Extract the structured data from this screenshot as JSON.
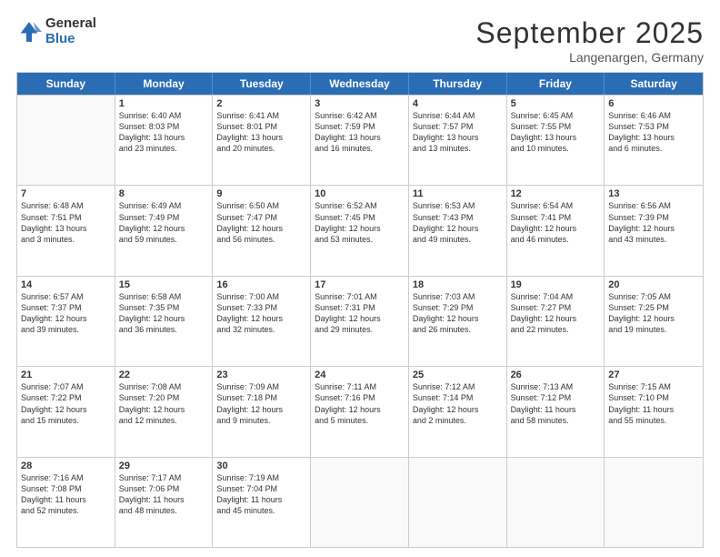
{
  "logo": {
    "general": "General",
    "blue": "Blue"
  },
  "header": {
    "month": "September 2025",
    "location": "Langenargen, Germany"
  },
  "weekdays": [
    "Sunday",
    "Monday",
    "Tuesday",
    "Wednesday",
    "Thursday",
    "Friday",
    "Saturday"
  ],
  "rows": [
    [
      {
        "day": "",
        "text": ""
      },
      {
        "day": "1",
        "text": "Sunrise: 6:40 AM\nSunset: 8:03 PM\nDaylight: 13 hours\nand 23 minutes."
      },
      {
        "day": "2",
        "text": "Sunrise: 6:41 AM\nSunset: 8:01 PM\nDaylight: 13 hours\nand 20 minutes."
      },
      {
        "day": "3",
        "text": "Sunrise: 6:42 AM\nSunset: 7:59 PM\nDaylight: 13 hours\nand 16 minutes."
      },
      {
        "day": "4",
        "text": "Sunrise: 6:44 AM\nSunset: 7:57 PM\nDaylight: 13 hours\nand 13 minutes."
      },
      {
        "day": "5",
        "text": "Sunrise: 6:45 AM\nSunset: 7:55 PM\nDaylight: 13 hours\nand 10 minutes."
      },
      {
        "day": "6",
        "text": "Sunrise: 6:46 AM\nSunset: 7:53 PM\nDaylight: 13 hours\nand 6 minutes."
      }
    ],
    [
      {
        "day": "7",
        "text": "Sunrise: 6:48 AM\nSunset: 7:51 PM\nDaylight: 13 hours\nand 3 minutes."
      },
      {
        "day": "8",
        "text": "Sunrise: 6:49 AM\nSunset: 7:49 PM\nDaylight: 12 hours\nand 59 minutes."
      },
      {
        "day": "9",
        "text": "Sunrise: 6:50 AM\nSunset: 7:47 PM\nDaylight: 12 hours\nand 56 minutes."
      },
      {
        "day": "10",
        "text": "Sunrise: 6:52 AM\nSunset: 7:45 PM\nDaylight: 12 hours\nand 53 minutes."
      },
      {
        "day": "11",
        "text": "Sunrise: 6:53 AM\nSunset: 7:43 PM\nDaylight: 12 hours\nand 49 minutes."
      },
      {
        "day": "12",
        "text": "Sunrise: 6:54 AM\nSunset: 7:41 PM\nDaylight: 12 hours\nand 46 minutes."
      },
      {
        "day": "13",
        "text": "Sunrise: 6:56 AM\nSunset: 7:39 PM\nDaylight: 12 hours\nand 43 minutes."
      }
    ],
    [
      {
        "day": "14",
        "text": "Sunrise: 6:57 AM\nSunset: 7:37 PM\nDaylight: 12 hours\nand 39 minutes."
      },
      {
        "day": "15",
        "text": "Sunrise: 6:58 AM\nSunset: 7:35 PM\nDaylight: 12 hours\nand 36 minutes."
      },
      {
        "day": "16",
        "text": "Sunrise: 7:00 AM\nSunset: 7:33 PM\nDaylight: 12 hours\nand 32 minutes."
      },
      {
        "day": "17",
        "text": "Sunrise: 7:01 AM\nSunset: 7:31 PM\nDaylight: 12 hours\nand 29 minutes."
      },
      {
        "day": "18",
        "text": "Sunrise: 7:03 AM\nSunset: 7:29 PM\nDaylight: 12 hours\nand 26 minutes."
      },
      {
        "day": "19",
        "text": "Sunrise: 7:04 AM\nSunset: 7:27 PM\nDaylight: 12 hours\nand 22 minutes."
      },
      {
        "day": "20",
        "text": "Sunrise: 7:05 AM\nSunset: 7:25 PM\nDaylight: 12 hours\nand 19 minutes."
      }
    ],
    [
      {
        "day": "21",
        "text": "Sunrise: 7:07 AM\nSunset: 7:22 PM\nDaylight: 12 hours\nand 15 minutes."
      },
      {
        "day": "22",
        "text": "Sunrise: 7:08 AM\nSunset: 7:20 PM\nDaylight: 12 hours\nand 12 minutes."
      },
      {
        "day": "23",
        "text": "Sunrise: 7:09 AM\nSunset: 7:18 PM\nDaylight: 12 hours\nand 9 minutes."
      },
      {
        "day": "24",
        "text": "Sunrise: 7:11 AM\nSunset: 7:16 PM\nDaylight: 12 hours\nand 5 minutes."
      },
      {
        "day": "25",
        "text": "Sunrise: 7:12 AM\nSunset: 7:14 PM\nDaylight: 12 hours\nand 2 minutes."
      },
      {
        "day": "26",
        "text": "Sunrise: 7:13 AM\nSunset: 7:12 PM\nDaylight: 11 hours\nand 58 minutes."
      },
      {
        "day": "27",
        "text": "Sunrise: 7:15 AM\nSunset: 7:10 PM\nDaylight: 11 hours\nand 55 minutes."
      }
    ],
    [
      {
        "day": "28",
        "text": "Sunrise: 7:16 AM\nSunset: 7:08 PM\nDaylight: 11 hours\nand 52 minutes."
      },
      {
        "day": "29",
        "text": "Sunrise: 7:17 AM\nSunset: 7:06 PM\nDaylight: 11 hours\nand 48 minutes."
      },
      {
        "day": "30",
        "text": "Sunrise: 7:19 AM\nSunset: 7:04 PM\nDaylight: 11 hours\nand 45 minutes."
      },
      {
        "day": "",
        "text": ""
      },
      {
        "day": "",
        "text": ""
      },
      {
        "day": "",
        "text": ""
      },
      {
        "day": "",
        "text": ""
      }
    ]
  ]
}
